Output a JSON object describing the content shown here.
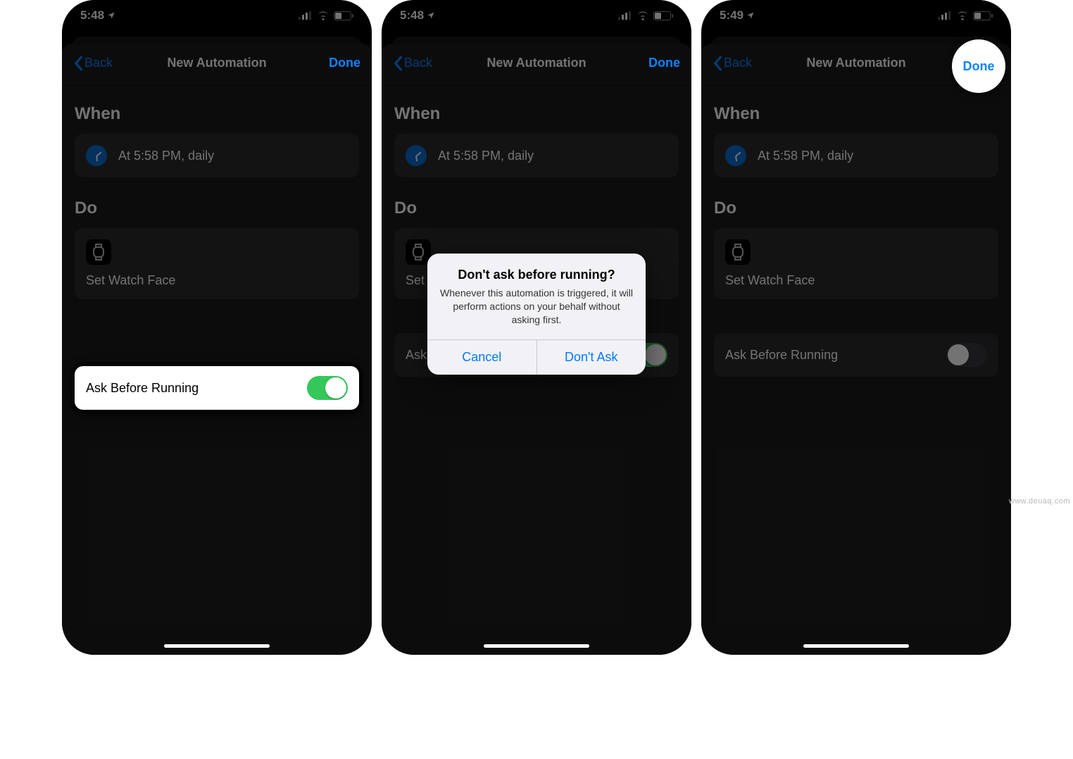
{
  "screens": [
    {
      "statusbar": {
        "time": "5:48"
      },
      "nav": {
        "back": "Back",
        "title": "New Automation",
        "done": "Done"
      },
      "sections": {
        "when_title": "When",
        "when_text": "At 5:58 PM, daily",
        "do_title": "Do",
        "do_text": "Set Watch Face",
        "ask_label": "Ask Before Running",
        "ask_on": true
      },
      "dimmed": true,
      "ask_row_style": "light"
    },
    {
      "statusbar": {
        "time": "5:48"
      },
      "nav": {
        "back": "Back",
        "title": "New Automation",
        "done": "Done"
      },
      "sections": {
        "when_title": "When",
        "when_text": "At 5:58 PM, daily",
        "do_title": "Do",
        "do_text": "Set Watch Face",
        "ask_label": "Ask Before Running",
        "ask_on": true
      },
      "dimmed": true,
      "alert": {
        "title": "Don't ask before running?",
        "message": "Whenever this automation is triggered, it will perform actions on your behalf without asking first.",
        "cancel": "Cancel",
        "confirm": "Don't Ask"
      }
    },
    {
      "statusbar": {
        "time": "5:49"
      },
      "nav": {
        "back": "Back",
        "title": "New Automation",
        "done": "Done"
      },
      "sections": {
        "when_title": "When",
        "when_text": "At 5:58 PM, daily",
        "do_title": "Do",
        "do_text": "Set Watch Face",
        "ask_label": "Ask Before Running",
        "ask_on": false
      },
      "dimmed": true,
      "done_highlight": true,
      "ask_row_style": "dark"
    }
  ],
  "watermark": "www.deuaq.com"
}
